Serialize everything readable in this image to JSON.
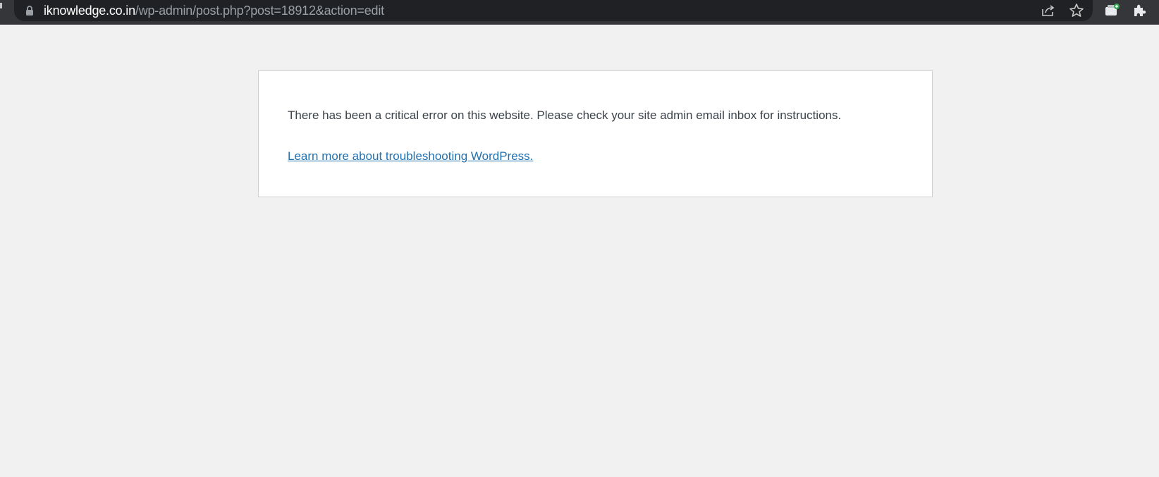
{
  "browser": {
    "url_host": "iknowledge.co.in",
    "url_path": "/wp-admin/post.php?post=18912&action=edit",
    "icons": [
      "lock-icon",
      "share-icon",
      "bookmark-star-icon",
      "extension-icon",
      "puzzle-extensions-icon"
    ]
  },
  "error": {
    "message": "There has been a critical error on this website. Please check your site admin email inbox for instructions.",
    "link_text": "Learn more about troubleshooting WordPress."
  },
  "colors": {
    "page_bg": "#f1f1f1",
    "toolbar_bg": "#35363a",
    "omnibox_bg": "#202124",
    "link": "#2271b1",
    "text": "#3c434a"
  }
}
